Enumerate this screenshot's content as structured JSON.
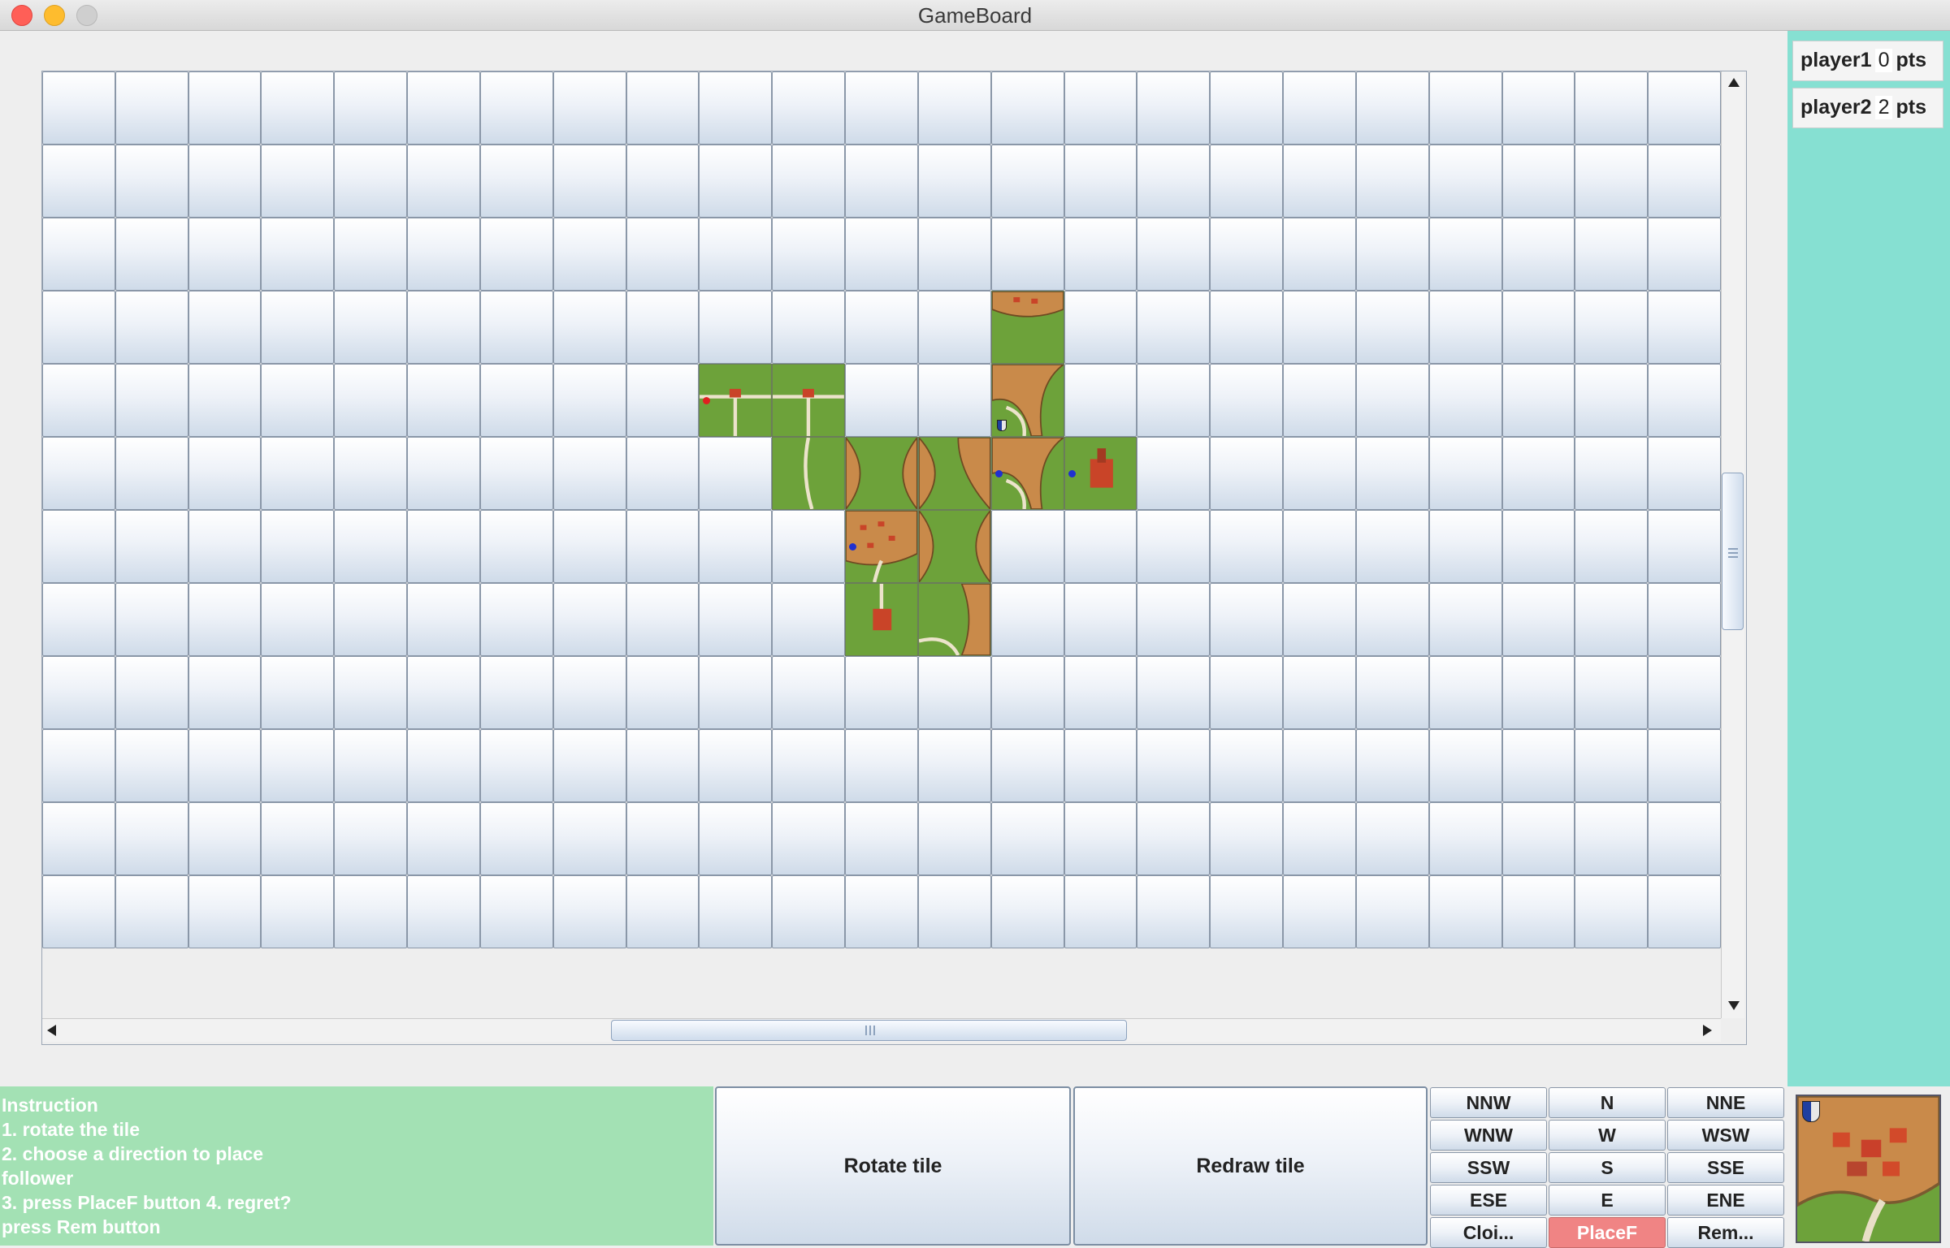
{
  "window": {
    "title": "GameBoard"
  },
  "board": {
    "columns": 23,
    "rows": 12,
    "placed_tiles": [
      {
        "row": 3,
        "col": 13,
        "kind": "city-cap"
      },
      {
        "row": 4,
        "col": 9,
        "kind": "road-junction",
        "follower": "red"
      },
      {
        "row": 4,
        "col": 10,
        "kind": "road-junction"
      },
      {
        "row": 4,
        "col": 13,
        "kind": "city-corner",
        "follower": "shield"
      },
      {
        "row": 5,
        "col": 10,
        "kind": "road-straight"
      },
      {
        "row": 5,
        "col": 11,
        "kind": "city-edge"
      },
      {
        "row": 5,
        "col": 12,
        "kind": "city-double"
      },
      {
        "row": 5,
        "col": 13,
        "kind": "city-corner",
        "follower": "blue"
      },
      {
        "row": 5,
        "col": 14,
        "kind": "monastery",
        "follower": "blue"
      },
      {
        "row": 6,
        "col": 11,
        "kind": "city-big",
        "follower": "blue"
      },
      {
        "row": 6,
        "col": 12,
        "kind": "city-edge"
      },
      {
        "row": 7,
        "col": 11,
        "kind": "monastery-road"
      },
      {
        "row": 7,
        "col": 12,
        "kind": "city-edge-road"
      }
    ]
  },
  "players": [
    {
      "name": "player1",
      "points": "0",
      "unit": "pts"
    },
    {
      "name": "player2",
      "points": "2",
      "unit": "pts"
    }
  ],
  "instructions": {
    "lines": [
      "Instruction",
      "1. rotate the tile",
      "2. choose a direction to place",
      "follower",
      "3. press PlaceF button 4. regret?",
      "press Rem button"
    ]
  },
  "controls": {
    "rotate_label": "Rotate tile",
    "redraw_label": "Redraw tile",
    "directions": [
      "NNW",
      "N",
      "NNE",
      "WNW",
      "W",
      "WSW",
      "SSW",
      "S",
      "SSE",
      "ESE",
      "E",
      "ENE"
    ],
    "cloister_label": "Cloi...",
    "placef_label": "PlaceF",
    "remove_label": "Rem..."
  },
  "colors": {
    "side_panel": "#86e0d2",
    "instruction_bg": "#a3e1b4",
    "placef_active": "#f08484",
    "grass": "#6da23a",
    "city": "#c98a4a",
    "follower_red": "#e02020",
    "follower_blue": "#2030d0"
  }
}
